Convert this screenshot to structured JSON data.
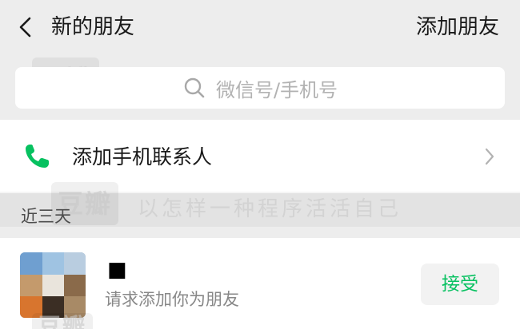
{
  "nav": {
    "title": "新的朋友",
    "action_label": "添加朋友"
  },
  "search": {
    "placeholder": "微信号/手机号"
  },
  "add_contacts": {
    "label": "添加手机联系人"
  },
  "section": {
    "label": "近三天"
  },
  "request": {
    "name": "■",
    "message": "请求添加你为朋友",
    "accept_label": "接受"
  },
  "watermark": {
    "brand": "豆瓣",
    "overlay_text": "以怎样一种程序活活自己"
  },
  "colors": {
    "background": "#ededed",
    "accent_green": "#07c160",
    "phone_icon_green": "#07c160",
    "secondary_text": "#888888"
  }
}
